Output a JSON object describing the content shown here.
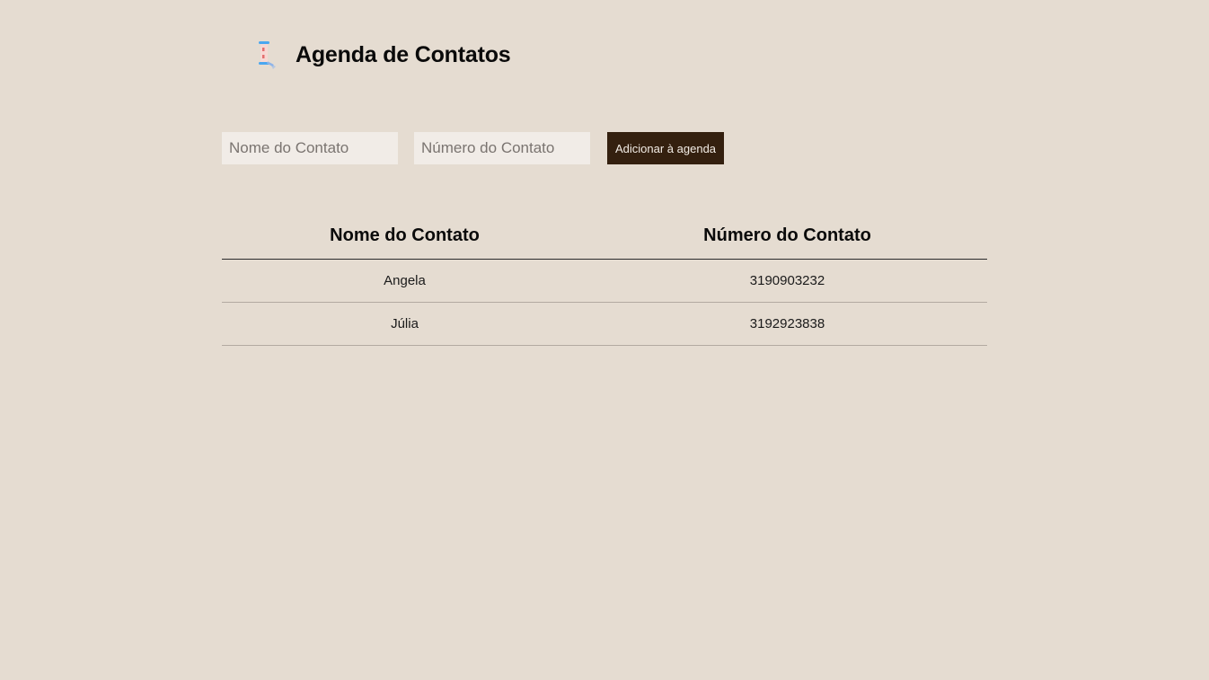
{
  "header": {
    "logo_icon": "scroll-icon",
    "title": "Agenda de Contatos"
  },
  "form": {
    "name_placeholder": "Nome do Contato",
    "name_value": "",
    "number_placeholder": "Número do Contato",
    "number_value": "",
    "add_label": "Adicionar à agenda"
  },
  "table": {
    "headers": [
      "Nome do Contato",
      "Número do Contato"
    ],
    "rows": [
      [
        "Angela",
        "3190903232"
      ],
      [
        "Júlia",
        "3192923838"
      ]
    ]
  },
  "colors": {
    "background": "#e5dcd1",
    "input_background": "#f1ece7",
    "button_background": "#34200f",
    "button_text": "#f3ede6"
  }
}
